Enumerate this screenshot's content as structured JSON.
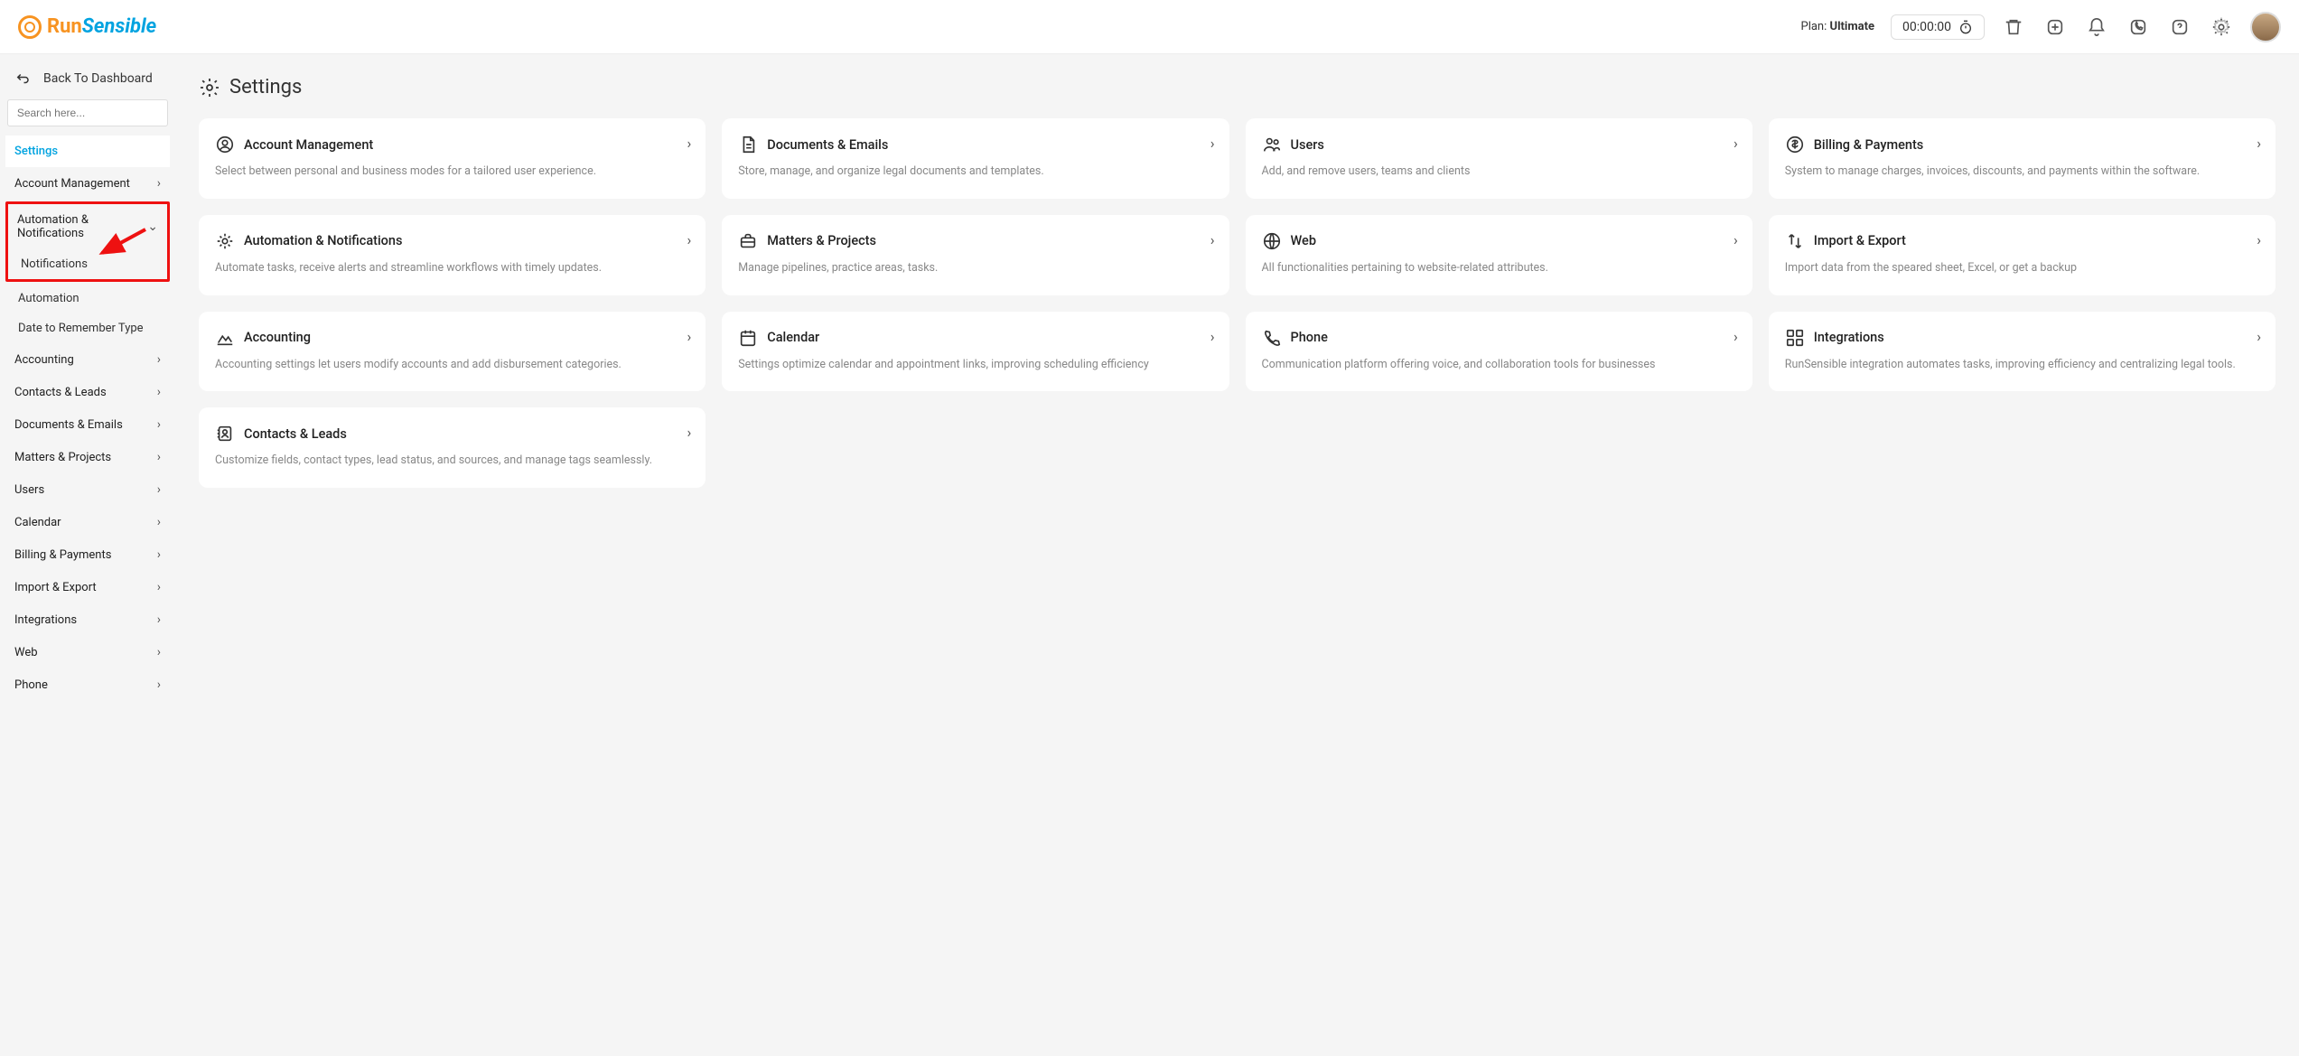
{
  "header": {
    "logo_run": "Run",
    "logo_sensible": "Sensible",
    "plan_prefix": "Plan: ",
    "plan_name": "Ultimate",
    "timer": "00:00:00"
  },
  "sidebar": {
    "back_label": "Back To Dashboard",
    "search_placeholder": "Search here...",
    "settings_label": "Settings",
    "items": [
      {
        "label": "Account Management"
      },
      {
        "label": "Automation & Notifications",
        "expanded": true,
        "children": [
          {
            "label": "Notifications"
          },
          {
            "label": "Automation"
          },
          {
            "label": "Date to Remember Type"
          }
        ]
      },
      {
        "label": "Accounting"
      },
      {
        "label": "Contacts & Leads"
      },
      {
        "label": "Documents & Emails"
      },
      {
        "label": "Matters & Projects"
      },
      {
        "label": "Users"
      },
      {
        "label": "Calendar"
      },
      {
        "label": "Billing & Payments"
      },
      {
        "label": "Import & Export"
      },
      {
        "label": "Integrations"
      },
      {
        "label": "Web"
      },
      {
        "label": "Phone"
      }
    ]
  },
  "page": {
    "title": "Settings"
  },
  "cards": [
    {
      "title": "Account Management",
      "desc": "Select between personal and business modes for a tailored user experience."
    },
    {
      "title": "Documents & Emails",
      "desc": "Store, manage, and organize legal documents and templates."
    },
    {
      "title": "Users",
      "desc": "Add, and remove users, teams and clients"
    },
    {
      "title": "Billing & Payments",
      "desc": "System to manage charges, invoices, discounts, and payments within the software."
    },
    {
      "title": "Automation & Notifications",
      "desc": "Automate tasks, receive alerts and streamline workflows with timely updates."
    },
    {
      "title": "Matters & Projects",
      "desc": "Manage pipelines, practice areas, tasks."
    },
    {
      "title": "Web",
      "desc": "All functionalities pertaining to website-related attributes."
    },
    {
      "title": "Import & Export",
      "desc": "Import data from the speared sheet, Excel, or get a backup"
    },
    {
      "title": "Accounting",
      "desc": "Accounting settings let users modify accounts and add disbursement categories."
    },
    {
      "title": "Calendar",
      "desc": "Settings optimize calendar and appointment links, improving scheduling efficiency"
    },
    {
      "title": "Phone",
      "desc": "Communication platform offering voice, and collaboration tools for businesses"
    },
    {
      "title": "Integrations",
      "desc": "RunSensible integration automates tasks, improving efficiency and centralizing legal tools."
    },
    {
      "title": "Contacts & Leads",
      "desc": "Customize fields, contact types, lead status, and sources, and manage tags seamlessly."
    }
  ]
}
